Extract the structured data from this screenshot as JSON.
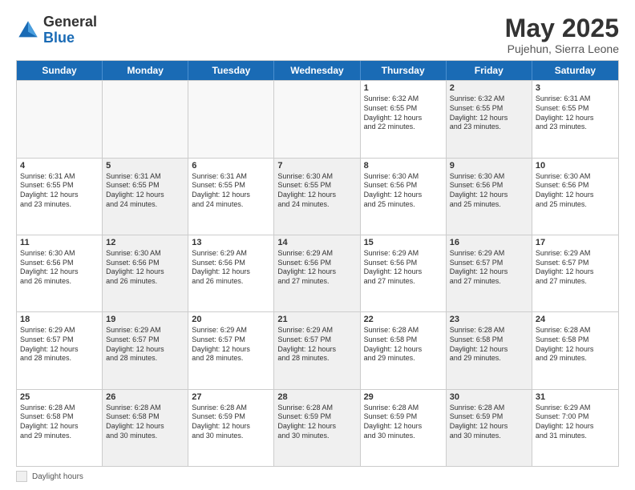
{
  "header": {
    "logo_line1": "General",
    "logo_line2": "Blue",
    "title": "May 2025",
    "location": "Pujehun, Sierra Leone"
  },
  "days_of_week": [
    "Sunday",
    "Monday",
    "Tuesday",
    "Wednesday",
    "Thursday",
    "Friday",
    "Saturday"
  ],
  "weeks": [
    [
      {
        "day": "",
        "info": "",
        "shaded": false,
        "empty": true
      },
      {
        "day": "",
        "info": "",
        "shaded": false,
        "empty": true
      },
      {
        "day": "",
        "info": "",
        "shaded": false,
        "empty": true
      },
      {
        "day": "",
        "info": "",
        "shaded": false,
        "empty": true
      },
      {
        "day": "1",
        "info": "Sunrise: 6:32 AM\nSunset: 6:55 PM\nDaylight: 12 hours\nand 22 minutes.",
        "shaded": false,
        "empty": false
      },
      {
        "day": "2",
        "info": "Sunrise: 6:32 AM\nSunset: 6:55 PM\nDaylight: 12 hours\nand 23 minutes.",
        "shaded": true,
        "empty": false
      },
      {
        "day": "3",
        "info": "Sunrise: 6:31 AM\nSunset: 6:55 PM\nDaylight: 12 hours\nand 23 minutes.",
        "shaded": false,
        "empty": false
      }
    ],
    [
      {
        "day": "4",
        "info": "Sunrise: 6:31 AM\nSunset: 6:55 PM\nDaylight: 12 hours\nand 23 minutes.",
        "shaded": false,
        "empty": false
      },
      {
        "day": "5",
        "info": "Sunrise: 6:31 AM\nSunset: 6:55 PM\nDaylight: 12 hours\nand 24 minutes.",
        "shaded": true,
        "empty": false
      },
      {
        "day": "6",
        "info": "Sunrise: 6:31 AM\nSunset: 6:55 PM\nDaylight: 12 hours\nand 24 minutes.",
        "shaded": false,
        "empty": false
      },
      {
        "day": "7",
        "info": "Sunrise: 6:30 AM\nSunset: 6:55 PM\nDaylight: 12 hours\nand 24 minutes.",
        "shaded": true,
        "empty": false
      },
      {
        "day": "8",
        "info": "Sunrise: 6:30 AM\nSunset: 6:56 PM\nDaylight: 12 hours\nand 25 minutes.",
        "shaded": false,
        "empty": false
      },
      {
        "day": "9",
        "info": "Sunrise: 6:30 AM\nSunset: 6:56 PM\nDaylight: 12 hours\nand 25 minutes.",
        "shaded": true,
        "empty": false
      },
      {
        "day": "10",
        "info": "Sunrise: 6:30 AM\nSunset: 6:56 PM\nDaylight: 12 hours\nand 25 minutes.",
        "shaded": false,
        "empty": false
      }
    ],
    [
      {
        "day": "11",
        "info": "Sunrise: 6:30 AM\nSunset: 6:56 PM\nDaylight: 12 hours\nand 26 minutes.",
        "shaded": false,
        "empty": false
      },
      {
        "day": "12",
        "info": "Sunrise: 6:30 AM\nSunset: 6:56 PM\nDaylight: 12 hours\nand 26 minutes.",
        "shaded": true,
        "empty": false
      },
      {
        "day": "13",
        "info": "Sunrise: 6:29 AM\nSunset: 6:56 PM\nDaylight: 12 hours\nand 26 minutes.",
        "shaded": false,
        "empty": false
      },
      {
        "day": "14",
        "info": "Sunrise: 6:29 AM\nSunset: 6:56 PM\nDaylight: 12 hours\nand 27 minutes.",
        "shaded": true,
        "empty": false
      },
      {
        "day": "15",
        "info": "Sunrise: 6:29 AM\nSunset: 6:56 PM\nDaylight: 12 hours\nand 27 minutes.",
        "shaded": false,
        "empty": false
      },
      {
        "day": "16",
        "info": "Sunrise: 6:29 AM\nSunset: 6:57 PM\nDaylight: 12 hours\nand 27 minutes.",
        "shaded": true,
        "empty": false
      },
      {
        "day": "17",
        "info": "Sunrise: 6:29 AM\nSunset: 6:57 PM\nDaylight: 12 hours\nand 27 minutes.",
        "shaded": false,
        "empty": false
      }
    ],
    [
      {
        "day": "18",
        "info": "Sunrise: 6:29 AM\nSunset: 6:57 PM\nDaylight: 12 hours\nand 28 minutes.",
        "shaded": false,
        "empty": false
      },
      {
        "day": "19",
        "info": "Sunrise: 6:29 AM\nSunset: 6:57 PM\nDaylight: 12 hours\nand 28 minutes.",
        "shaded": true,
        "empty": false
      },
      {
        "day": "20",
        "info": "Sunrise: 6:29 AM\nSunset: 6:57 PM\nDaylight: 12 hours\nand 28 minutes.",
        "shaded": false,
        "empty": false
      },
      {
        "day": "21",
        "info": "Sunrise: 6:29 AM\nSunset: 6:57 PM\nDaylight: 12 hours\nand 28 minutes.",
        "shaded": true,
        "empty": false
      },
      {
        "day": "22",
        "info": "Sunrise: 6:28 AM\nSunset: 6:58 PM\nDaylight: 12 hours\nand 29 minutes.",
        "shaded": false,
        "empty": false
      },
      {
        "day": "23",
        "info": "Sunrise: 6:28 AM\nSunset: 6:58 PM\nDaylight: 12 hours\nand 29 minutes.",
        "shaded": true,
        "empty": false
      },
      {
        "day": "24",
        "info": "Sunrise: 6:28 AM\nSunset: 6:58 PM\nDaylight: 12 hours\nand 29 minutes.",
        "shaded": false,
        "empty": false
      }
    ],
    [
      {
        "day": "25",
        "info": "Sunrise: 6:28 AM\nSunset: 6:58 PM\nDaylight: 12 hours\nand 29 minutes.",
        "shaded": false,
        "empty": false
      },
      {
        "day": "26",
        "info": "Sunrise: 6:28 AM\nSunset: 6:58 PM\nDaylight: 12 hours\nand 30 minutes.",
        "shaded": true,
        "empty": false
      },
      {
        "day": "27",
        "info": "Sunrise: 6:28 AM\nSunset: 6:59 PM\nDaylight: 12 hours\nand 30 minutes.",
        "shaded": false,
        "empty": false
      },
      {
        "day": "28",
        "info": "Sunrise: 6:28 AM\nSunset: 6:59 PM\nDaylight: 12 hours\nand 30 minutes.",
        "shaded": true,
        "empty": false
      },
      {
        "day": "29",
        "info": "Sunrise: 6:28 AM\nSunset: 6:59 PM\nDaylight: 12 hours\nand 30 minutes.",
        "shaded": false,
        "empty": false
      },
      {
        "day": "30",
        "info": "Sunrise: 6:28 AM\nSunset: 6:59 PM\nDaylight: 12 hours\nand 30 minutes.",
        "shaded": true,
        "empty": false
      },
      {
        "day": "31",
        "info": "Sunrise: 6:29 AM\nSunset: 7:00 PM\nDaylight: 12 hours\nand 31 minutes.",
        "shaded": false,
        "empty": false
      }
    ]
  ],
  "footer": {
    "note_label": "Daylight hours"
  }
}
